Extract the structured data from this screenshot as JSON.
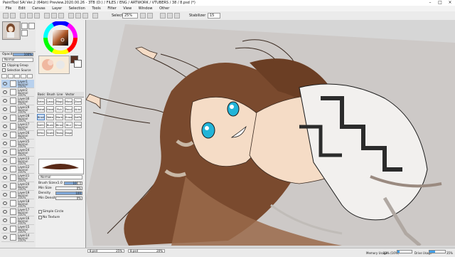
{
  "window": {
    "title": "PaintTool SAI Ver.2 (64bit) Preview.2020.00.26 - 3TB (D:) / FILES / ENG / ARTWORK / VTUBERS / 38 / 8.psd (*)",
    "min_icon": "minimize-icon",
    "max_icon": "maximize-icon",
    "close_icon": "close-icon"
  },
  "menu": [
    "File",
    "Edit",
    "Canvas",
    "Layer",
    "Selection",
    "Tools",
    "Filter",
    "View",
    "Window",
    "Other"
  ],
  "toolbar": {
    "selection_label": "Selection",
    "selection_zoom": "25%",
    "stabilizer_label": "Stabilizer",
    "stabilizer_value": "15"
  },
  "left_panel": {
    "color_wheel_icon": "color-wheel-icon",
    "current_color": "#5a3020",
    "layer_props": {
      "opacity_label": "Opacity",
      "opacity_value": "100%",
      "blend_label": "Normal",
      "clipping_label": "Clipping Group",
      "selection_source_label": "Selection Source"
    },
    "layers": [
      {
        "name": "Layer1",
        "mode": "Normal",
        "opacity": "100%"
      },
      {
        "name": "Layer2",
        "mode": "Normal",
        "opacity": "100%"
      },
      {
        "name": "Layer30",
        "mode": "Normal",
        "opacity": "100%"
      },
      {
        "name": "Layer29",
        "mode": "Normal",
        "opacity": "100%"
      },
      {
        "name": "Layer28",
        "mode": "Normal",
        "opacity": "100%"
      },
      {
        "name": "Layer27",
        "mode": "Normal",
        "opacity": "100%"
      },
      {
        "name": "Layer26",
        "mode": "Normal",
        "opacity": "100%"
      },
      {
        "name": "Layer25",
        "mode": "Normal",
        "opacity": "100%"
      },
      {
        "name": "Layer24",
        "mode": "Normal",
        "opacity": "100%"
      },
      {
        "name": "Layer23",
        "mode": "Normal",
        "opacity": "100%"
      },
      {
        "name": "Layer22",
        "mode": "Normal",
        "opacity": "100%"
      },
      {
        "name": "Layer21",
        "mode": "Normal",
        "opacity": "100%"
      },
      {
        "name": "Layer20",
        "mode": "Normal",
        "opacity": "100%"
      },
      {
        "name": "Layer19",
        "mode": "Normal",
        "opacity": "100%"
      },
      {
        "name": "Layer18",
        "mode": "Normal",
        "opacity": "100%"
      },
      {
        "name": "Layer17",
        "mode": "Normal",
        "opacity": "100%"
      },
      {
        "name": "Layer16",
        "mode": "Normal",
        "opacity": "100%"
      },
      {
        "name": "Layer15",
        "mode": "Normal",
        "opacity": "100%"
      },
      {
        "name": "Layer14",
        "mode": "Normal",
        "opacity": "100%"
      }
    ]
  },
  "tools_panel": {
    "tab_labels": [
      "Basic",
      "Brush",
      "Line",
      "Vector"
    ],
    "tools": [
      "Select",
      "Lasso",
      "Magic",
      "Move",
      "Zoom",
      "Rotate",
      "Hand",
      "Pick",
      "Pencil",
      "Airbrush",
      "Brush",
      "Water",
      "Marker",
      "Eraser",
      "SelPen",
      "SelErs",
      "Bucket",
      "Binary",
      "Blur",
      "Smudge",
      "Effect",
      "Scatter",
      "Texture",
      "Edge"
    ],
    "brush_mode_label": "Normal",
    "brush_size_label": "Brush Size",
    "brush_size_mult": "x1.0",
    "brush_size_value": "100.0",
    "min_size_label": "Min Size",
    "min_size_value": "0%",
    "density_label": "Density",
    "density_value": "100",
    "min_density_label": "Min Density",
    "min_density_value": "0%",
    "simple_circle_label": "Simple Circle",
    "no_texture_label": "No Texture"
  },
  "canvas": {
    "bg_color": "#cdc9c7",
    "hair_color": "#7a4a2e",
    "skin_color": "#f5dcc6",
    "outfit_color": "#f2f0ee",
    "outfit_trim": "#2b2b2b",
    "eye_color": "#22b4d8"
  },
  "status": {
    "tabs": [
      {
        "label": "8.psd",
        "zoom": "25%"
      },
      {
        "label": "8.psd",
        "zoom": "20%"
      }
    ],
    "memory_label": "Memory Usage",
    "memory_value": "13%",
    "memory_extra": "(16%)",
    "memory_level": 0.13,
    "drive_label": "Drive Usage",
    "drive_value": "35%",
    "drive_level": 0.35
  }
}
